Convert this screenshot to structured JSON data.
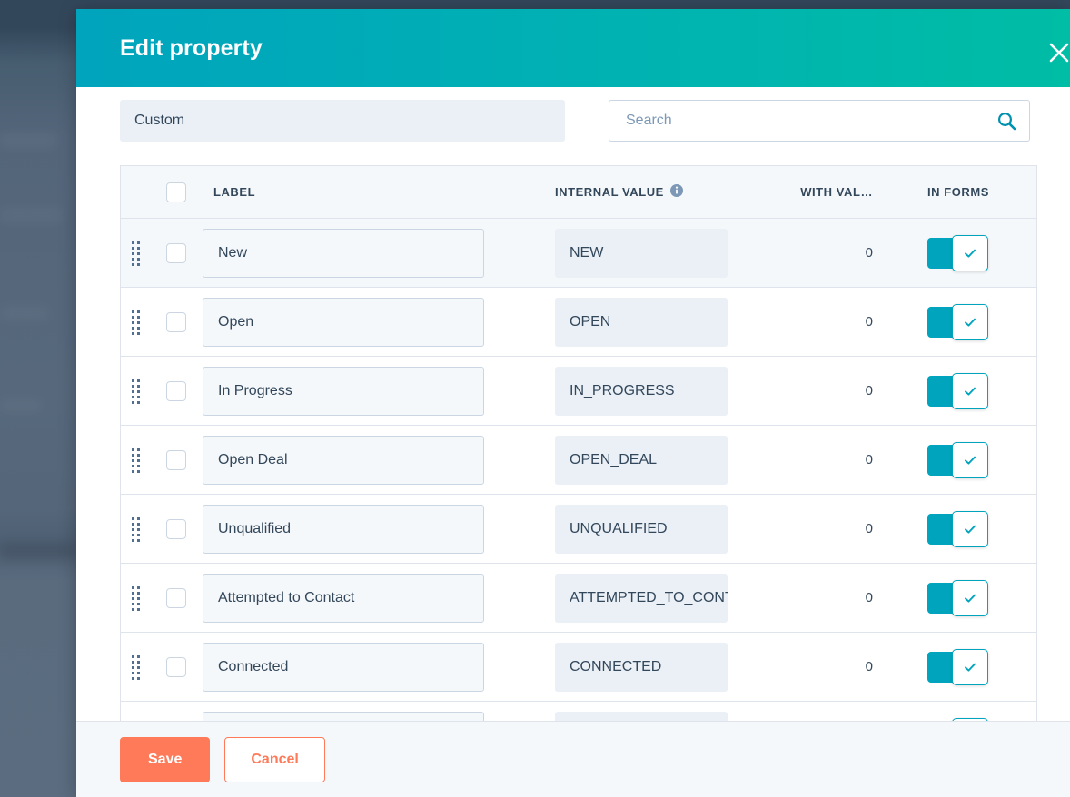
{
  "modal": {
    "title": "Edit property",
    "close_icon": "close-icon"
  },
  "filters": {
    "type_select_value": "Custom",
    "search_placeholder": "Search",
    "search_value": "",
    "search_icon": "search-icon"
  },
  "table": {
    "headers": {
      "label": "LABEL",
      "internal_value": "INTERNAL VALUE",
      "with_value": "WITH VAL…",
      "in_forms": "IN FORMS",
      "info_icon": "info-icon"
    },
    "rows": [
      {
        "label": "New",
        "internal_value": "NEW",
        "with_value": "0",
        "in_forms": true
      },
      {
        "label": "Open",
        "internal_value": "OPEN",
        "with_value": "0",
        "in_forms": true
      },
      {
        "label": "In Progress",
        "internal_value": "IN_PROGRESS",
        "with_value": "0",
        "in_forms": true
      },
      {
        "label": "Open Deal",
        "internal_value": "OPEN_DEAL",
        "with_value": "0",
        "in_forms": true
      },
      {
        "label": "Unqualified",
        "internal_value": "UNQUALIFIED",
        "with_value": "0",
        "in_forms": true
      },
      {
        "label": "Attempted to Contact",
        "internal_value": "ATTEMPTED_TO_CONTACT",
        "with_value": "0",
        "in_forms": true
      },
      {
        "label": "Connected",
        "internal_value": "CONNECTED",
        "with_value": "0",
        "in_forms": true
      },
      {
        "label": "",
        "internal_value": "",
        "with_value": "",
        "in_forms": true
      }
    ]
  },
  "footer": {
    "save_label": "Save",
    "cancel_label": "Cancel"
  },
  "colors": {
    "header_gradient_start": "#00a4bd",
    "header_gradient_end": "#00bda5",
    "accent_orange": "#ff7a59",
    "toggle_on": "#00a4bd",
    "text_dark": "#33475b",
    "row_tint": "#f5f8fa"
  }
}
